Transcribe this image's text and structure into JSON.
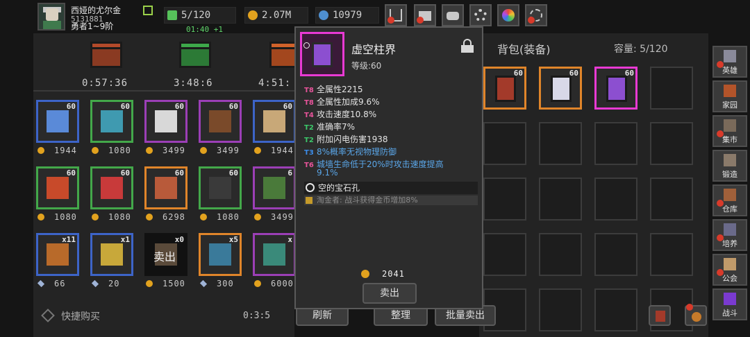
{
  "player": {
    "name": "西娅的尤尔金",
    "id": "5131881",
    "rank": "勇者1~9阶"
  },
  "resources": {
    "energy": "5/120",
    "energy_timer": "01:40 +1",
    "gold": "2.07M",
    "gems": "10979"
  },
  "top_buttons": [
    "shop-cart-icon",
    "mail-icon",
    "gamepad-icon",
    "gear-icon",
    "color-wheel-icon",
    "firework-icon"
  ],
  "shop": {
    "chest_timers": [
      "0:57:36",
      "3:48:6",
      "4:51:"
    ],
    "items": [
      {
        "level": "60",
        "price": "1944",
        "currency": "coin",
        "icon": "staff-icon",
        "border": "#3d64c8"
      },
      {
        "level": "60",
        "price": "1080",
        "currency": "coin",
        "icon": "book-icon",
        "border": "#43a84a"
      },
      {
        "level": "60",
        "price": "3499",
        "currency": "coin",
        "icon": "dagger-icon",
        "border": "#9b3fb6"
      },
      {
        "level": "60",
        "price": "3499",
        "currency": "coin",
        "icon": "bow-icon",
        "border": "#9b3fb6"
      },
      {
        "level": "60",
        "price": "1944",
        "currency": "coin",
        "icon": "scythe-icon",
        "border": "#3d64c8"
      },
      {
        "level": "60",
        "price": "1080",
        "currency": "coin",
        "icon": "hood-icon",
        "border": "#43a84a"
      },
      {
        "level": "60",
        "price": "1080",
        "currency": "coin",
        "icon": "robe-icon",
        "border": "#43a84a"
      },
      {
        "level": "60",
        "price": "6298",
        "currency": "coin",
        "icon": "gauntlet-icon",
        "border": "#e0852a"
      },
      {
        "level": "60",
        "price": "1080",
        "currency": "coin",
        "icon": "pants-icon",
        "border": "#43a84a"
      },
      {
        "level": "6",
        "price": "3499",
        "currency": "coin",
        "icon": "boots-icon",
        "border": "#9b3fb6"
      },
      {
        "level": "x11",
        "price": "66",
        "currency": "diamond",
        "icon": "tome-icon",
        "border": "#3d64c8"
      },
      {
        "level": "x1",
        "price": "20",
        "currency": "diamond",
        "icon": "rune-icon",
        "border": "#3d64c8"
      },
      {
        "level": "x0",
        "price": "1500",
        "currency": "coin",
        "icon": "scroll-icon",
        "border": "#111111",
        "sold": "卖出"
      },
      {
        "level": "x5",
        "price": "300",
        "currency": "diamond",
        "icon": "spellbook-icon",
        "border": "#e0852a"
      },
      {
        "level": "x",
        "price": "6000",
        "currency": "coin",
        "icon": "chest-icon",
        "border": "#9b3fb6"
      }
    ],
    "quick_buy": "快捷购买",
    "refresh_timer": "0:3:5",
    "refresh_button": "刷新"
  },
  "bag": {
    "title": "背包(装备)",
    "capacity": "容量: 5/120",
    "organize_button": "整理",
    "bulk_sell_button": "批量卖出"
  },
  "tooltip": {
    "name": "虚空柱界",
    "level": "等级:60",
    "attributes": [
      {
        "tier": "T8",
        "text": "全属性2215",
        "tier_color": "#e8549b",
        "blue": false
      },
      {
        "tier": "T8",
        "text": "全属性加成9.6%",
        "tier_color": "#e8549b",
        "blue": false
      },
      {
        "tier": "T4",
        "text": "攻击速度10.8%",
        "tier_color": "#e8549b",
        "blue": false
      },
      {
        "tier": "T2",
        "text": "准确率7%",
        "tier_color": "#3cc86a",
        "blue": false
      },
      {
        "tier": "T2",
        "text": "附加闪电伤害1938",
        "tier_color": "#3cc86a",
        "blue": false
      },
      {
        "tier": "T3",
        "text": "8%概率无视物理防御",
        "tier_color": "#3c8ce8",
        "blue": true
      },
      {
        "tier": "T6",
        "text": "城墙生命低于20%时攻击速度提高",
        "tier_color": "#e8549b",
        "blue": true
      },
      {
        "tier": "",
        "text": "9.1%",
        "tier_color": "#e8549b",
        "blue": true
      }
    ],
    "socket": "空的宝石孔",
    "set_bonus": "淘金者: 战斗获得金币增加8%",
    "price": "2041",
    "sell_button": "卖出"
  },
  "sidebar": [
    {
      "label": "英雄",
      "icon": "helmet-icon",
      "alert": true
    },
    {
      "label": "家园",
      "icon": "castle-icon",
      "alert": false
    },
    {
      "label": "集市",
      "icon": "market-icon",
      "alert": true
    },
    {
      "label": "锻造",
      "icon": "anvil-icon",
      "alert": false
    },
    {
      "label": "仓库",
      "icon": "warehouse-icon",
      "alert": true
    },
    {
      "label": "培养",
      "icon": "altar-icon",
      "alert": true
    },
    {
      "label": "公会",
      "icon": "guild-icon",
      "alert": true
    },
    {
      "label": "战斗",
      "icon": "portal-icon",
      "alert": false
    }
  ]
}
